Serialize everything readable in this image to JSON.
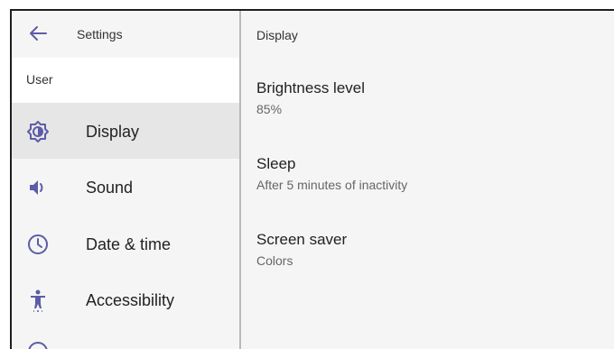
{
  "header": {
    "title": "Settings",
    "back_icon": "arrow-left-icon"
  },
  "sidebar": {
    "section_label": "User",
    "items": [
      {
        "label": "Display",
        "icon": "brightness-icon",
        "selected": true
      },
      {
        "label": "Sound",
        "icon": "volume-icon",
        "selected": false
      },
      {
        "label": "Date & time",
        "icon": "clock-icon",
        "selected": false
      },
      {
        "label": "Accessibility",
        "icon": "accessibility-icon",
        "selected": false
      }
    ]
  },
  "content": {
    "title": "Display",
    "prefs": [
      {
        "title": "Brightness level",
        "summary": "85%"
      },
      {
        "title": "Sleep",
        "summary": "After 5 minutes of inactivity"
      },
      {
        "title": "Screen saver",
        "summary": "Colors"
      }
    ]
  },
  "colors": {
    "accent": "#5c5ca8",
    "selected_bg": "#e6e6e6",
    "background": "#f5f5f5"
  }
}
